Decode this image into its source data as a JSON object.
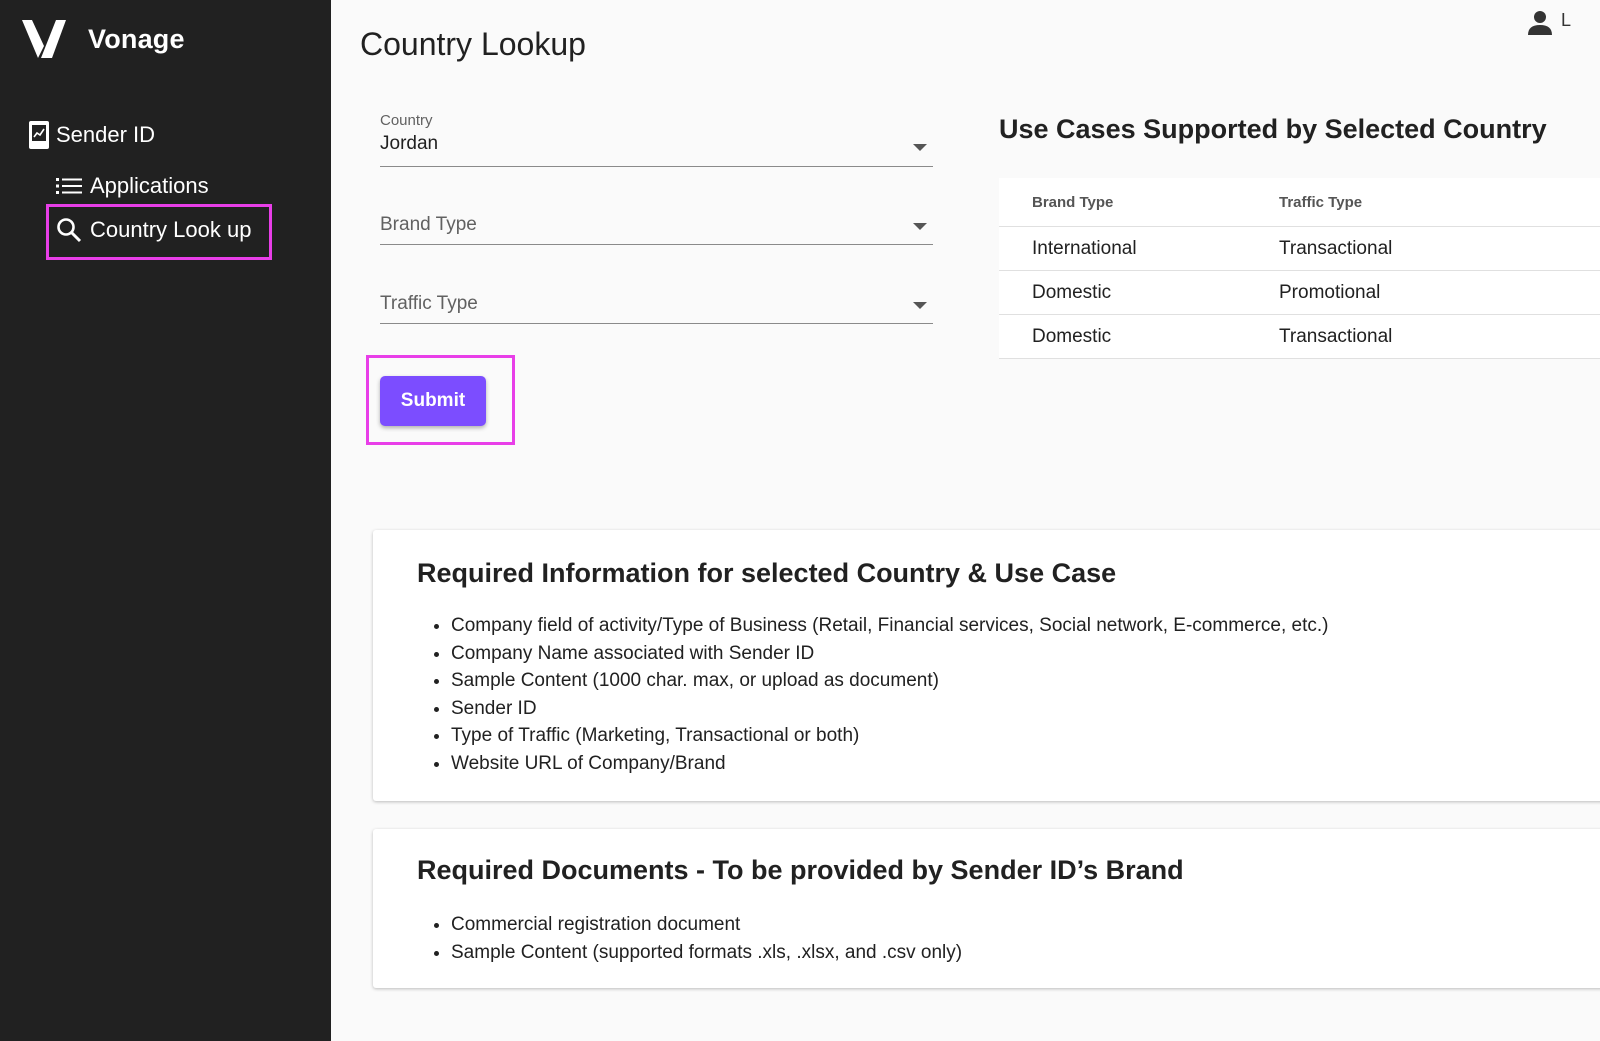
{
  "sidebar": {
    "brand": "Vonage",
    "section_label": "Sender ID",
    "items": [
      {
        "label": "Applications",
        "icon": "list-icon"
      },
      {
        "label": "Country Look up",
        "icon": "search-icon"
      }
    ]
  },
  "header": {
    "title": "Country Lookup",
    "user_initial": "L"
  },
  "form": {
    "country": {
      "label": "Country",
      "value": "Jordan"
    },
    "brand_type": {
      "placeholder": "Brand Type"
    },
    "traffic_type": {
      "placeholder": "Traffic Type"
    },
    "submit_label": "Submit"
  },
  "use_cases": {
    "title": "Use Cases Supported by Selected Country",
    "columns": [
      "Brand Type",
      "Traffic Type"
    ],
    "rows": [
      [
        "International",
        "Transactional"
      ],
      [
        "Domestic",
        "Promotional"
      ],
      [
        "Domestic",
        "Transactional"
      ]
    ]
  },
  "required_info": {
    "title": "Required Information for selected Country & Use Case",
    "items": [
      "Company field of activity/Type of Business (Retail, Financial services, Social network, E-commerce, etc.)",
      "Company Name associated with Sender ID",
      "Sample Content (1000 char. max, or upload as document)",
      "Sender ID",
      "Type of Traffic (Marketing, Transactional or both)",
      "Website URL of Company/Brand"
    ]
  },
  "required_docs": {
    "title": "Required Documents - To be provided by Sender ID’s Brand",
    "items": [
      "Commercial registration document",
      "Sample Content (supported formats .xls, .xlsx, and .csv only)"
    ]
  },
  "colors": {
    "sidebar_bg": "#212121",
    "accent": "#7c4dff",
    "highlight": "#e83ee8"
  }
}
